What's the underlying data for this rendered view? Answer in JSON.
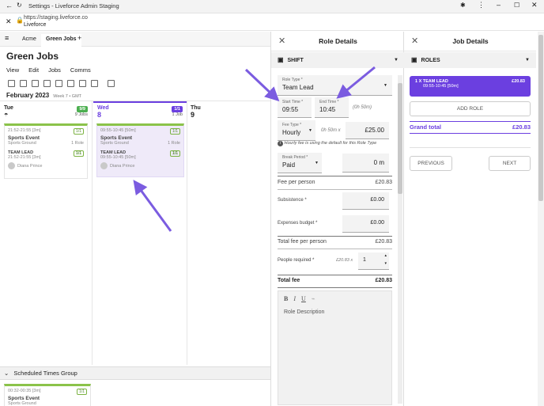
{
  "browser": {
    "window_title": "Settings - Liveforce Admin Staging",
    "url": "https://staging.liveforce.co",
    "site_name": "Liveforce"
  },
  "tabs": [
    {
      "label": "Acme"
    },
    {
      "label": "Green Jobs"
    }
  ],
  "page": {
    "title": "Green Jobs",
    "menu": [
      "View",
      "Edit",
      "Jobs",
      "Comms"
    ],
    "month": "February 2023",
    "week": "Week 7 • GMT"
  },
  "days": [
    {
      "name": "Tue",
      "num": "7",
      "badge": "9/9",
      "count": "9 Jobs"
    },
    {
      "name": "Wed",
      "num": "8",
      "badge": "1/1",
      "count": "1 Job"
    },
    {
      "name": "Thu",
      "num": "9"
    }
  ],
  "cards": {
    "tue": {
      "time": "21:52-21:55 [3m]",
      "badge": "1/1",
      "name": "Sports Event",
      "venue": "Sports Ground",
      "roles": "1 Role",
      "role_label": "TEAM LEAD",
      "role_time": "21:52-21:55 [3m]",
      "role_badge": "1/1",
      "person": "Diana Prince"
    },
    "wed": {
      "time": "09:55-10:45 [50m]",
      "badge": "1/1",
      "name": "Sports Event",
      "venue": "Sports Ground",
      "roles": "1 Role",
      "role_label": "TEAM LEAD",
      "role_time": "09:55-10:45 [50m]",
      "role_badge": "1/1",
      "person": "Diana Prince"
    },
    "group": {
      "time": "00:32-00:35 [3m]",
      "badge": "1/1",
      "name": "Sports Event",
      "venue": "Sports Ground"
    }
  },
  "group_label": "Scheduled Times Group",
  "role_details": {
    "title": "Role Details",
    "section": "SHIFT",
    "role_type_label": "Role Type *",
    "role_type_value": "Team Lead",
    "start_label": "Start Time *",
    "start_value": "09:55",
    "end_label": "End Time *",
    "end_value": "10:45",
    "duration": "(0h 50m)",
    "fee_type_label": "Fee Type *",
    "fee_type_value": "Hourly",
    "fee_mult": "0h 50m x",
    "fee_value": "£25.00",
    "hint": "Hourly fee is using the default for this Role Type",
    "break_label": "Break Period *",
    "break_value": "Paid",
    "break_minutes": "0 m",
    "fee_per_person_label": "Fee per person",
    "fee_per_person_value": "£20.83",
    "subsistence_label": "Subsistence *",
    "subsistence_value": "£0.00",
    "expenses_label": "Expenses budget *",
    "expenses_value": "£0.00",
    "total_fee_pp_label": "Total fee per person",
    "total_fee_pp_value": "£20.83",
    "people_label": "People required *",
    "people_mult": "£20.83 x",
    "people_value": "1",
    "total_fee_label": "Total fee",
    "total_fee_value": "£20.83",
    "description_placeholder": "Role Description"
  },
  "job_details": {
    "title": "Job Details",
    "section": "ROLES",
    "role_item_label": "1 X  TEAM LEAD",
    "role_item_time": "09:55-10:45 [50m]",
    "role_item_fee": "£20.83",
    "add_role": "ADD ROLE",
    "grand_total_label": "Grand total",
    "grand_total_value": "£20.83",
    "previous": "PREVIOUS",
    "next": "NEXT"
  },
  "colors": {
    "accent": "#6b3fe0",
    "green": "#8bc34a",
    "arrow": "#7b5ce0"
  }
}
